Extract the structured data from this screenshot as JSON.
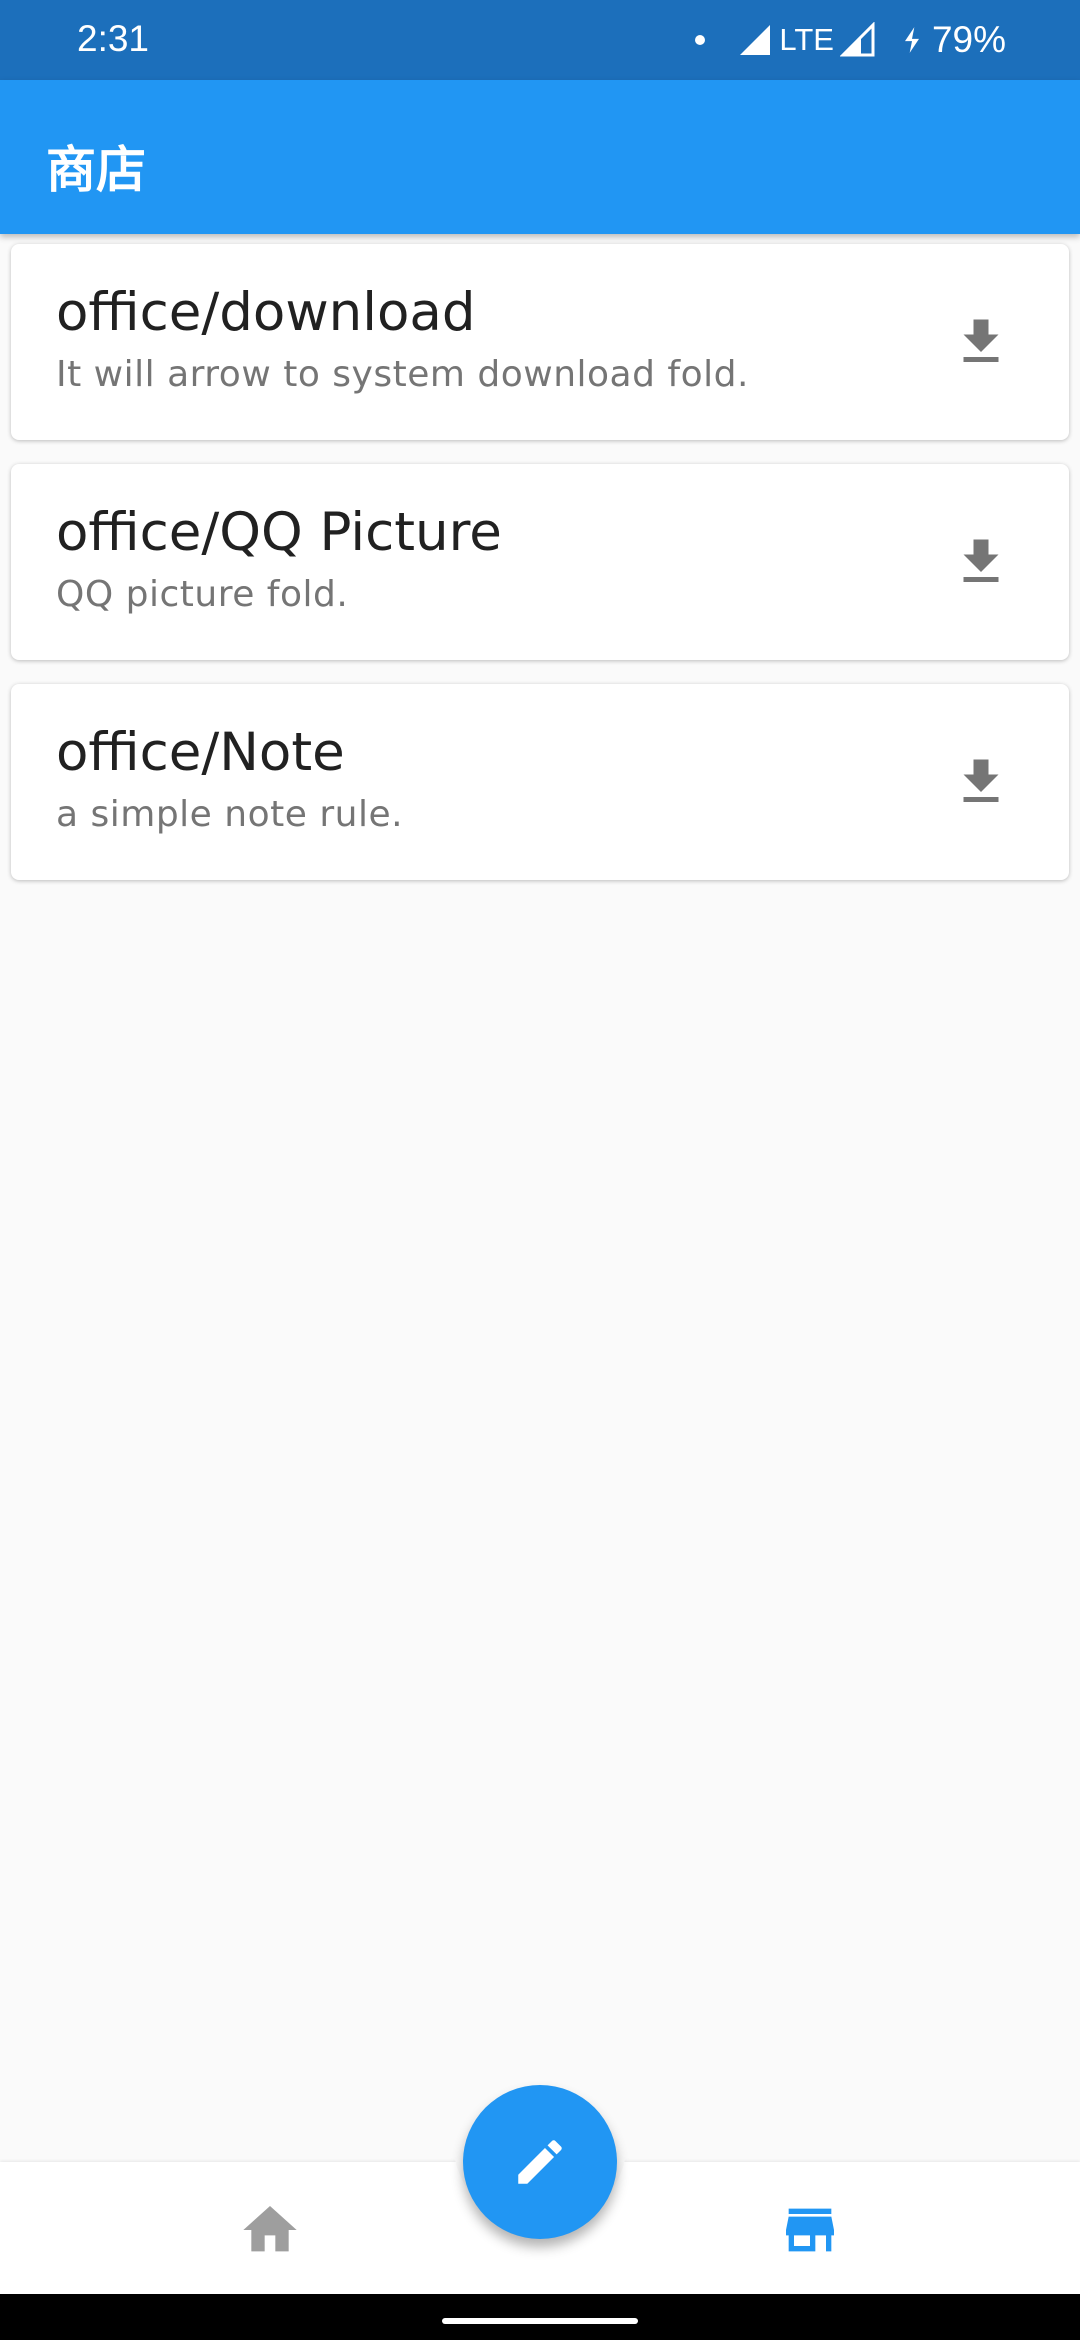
{
  "status_bar": {
    "time": "2:31",
    "network": "LTE",
    "battery": "79%"
  },
  "app_bar": {
    "title": "商店"
  },
  "items": [
    {
      "title": "office/download",
      "subtitle": "It will arrow to system download fold."
    },
    {
      "title": "office/QQ Picture",
      "subtitle": "QQ picture fold."
    },
    {
      "title": "office/Note",
      "subtitle": "a simple note rule."
    }
  ],
  "icons": {
    "item_action": "download-icon",
    "fab": "edit-icon",
    "nav_left": "home-icon",
    "nav_right": "store-icon"
  },
  "colors": {
    "primary": "#2196f3",
    "status_bar": "#1c6fbb",
    "nav_active": "#2196f3",
    "nav_inactive": "#9e9e9e",
    "icon_gray": "#757575"
  },
  "bottom_nav": {
    "selected": "store"
  }
}
